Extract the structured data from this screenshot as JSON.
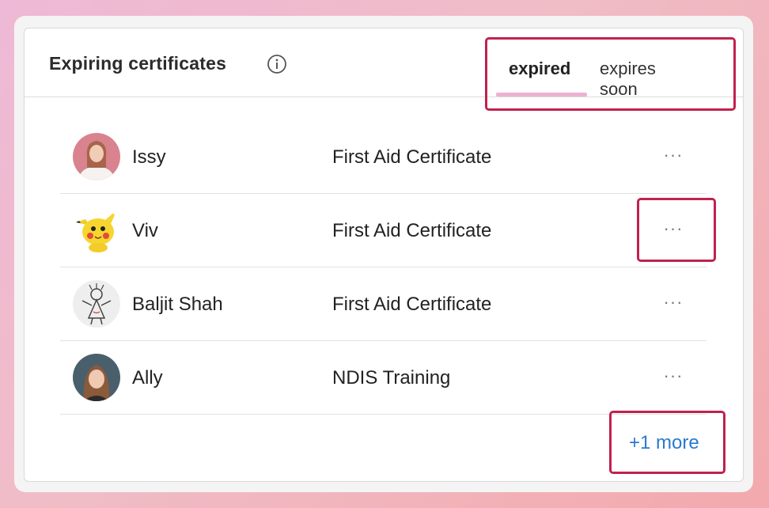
{
  "card": {
    "title": "Expiring certificates",
    "info_icon": "info-circle-icon"
  },
  "tabs": [
    {
      "label": "expired",
      "active": true
    },
    {
      "label": "expires soon",
      "active": false
    }
  ],
  "rows": [
    {
      "name": "Issy",
      "certificate": "First Aid Certificate",
      "avatar": "woman-portrait-avatar",
      "action": "···"
    },
    {
      "name": "Viv",
      "certificate": "First Aid Certificate",
      "avatar": "pikachu-avatar",
      "action": "···"
    },
    {
      "name": "Baljit Shah",
      "certificate": "First Aid Certificate",
      "avatar": "stick-figure-drawing-avatar",
      "action": "···"
    },
    {
      "name": "Ally",
      "certificate": "NDIS Training",
      "avatar": "woman-portrait-avatar",
      "action": "···"
    }
  ],
  "more_link": "+1 more",
  "colors": {
    "accent_underline": "#ecb1d3",
    "highlight_box": "#c0224d",
    "link": "#2a7ad0"
  }
}
